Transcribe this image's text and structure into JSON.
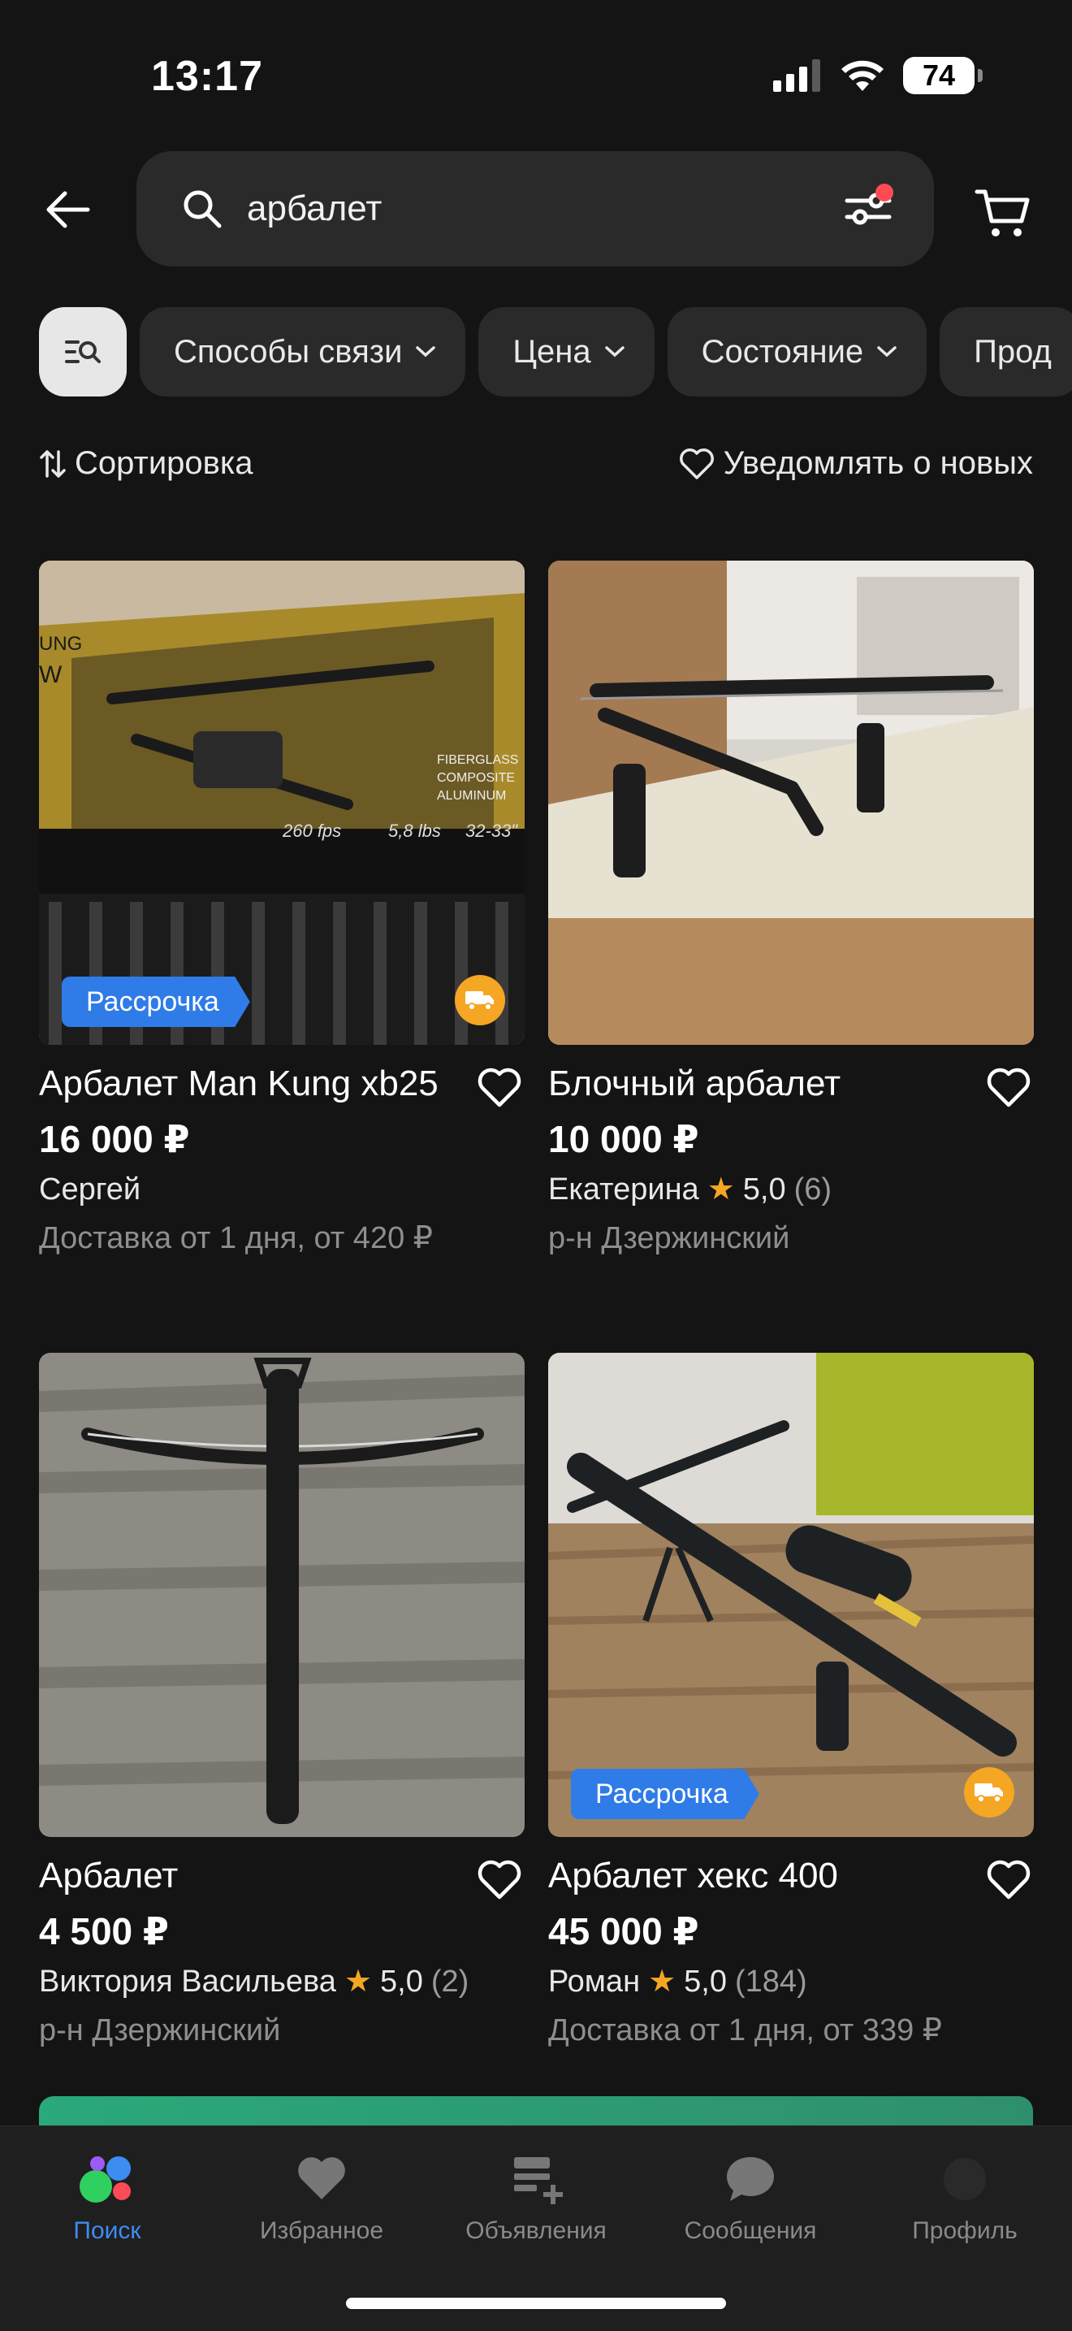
{
  "status_bar": {
    "time": "13:17",
    "battery": "74"
  },
  "search": {
    "query": "арбалет"
  },
  "filters": {
    "chips": [
      "Способы связи",
      "Цена",
      "Состояние",
      "Прод"
    ]
  },
  "sort": {
    "label": "Сортировка",
    "notify": "Уведомлять о новых"
  },
  "listings": [
    {
      "title": "Арбалет Man Kung xb25",
      "price": "16 000 ₽",
      "seller": "Сергей",
      "meta": "Доставка от 1 дня, от 420 ₽",
      "badge": "Рассрочка",
      "photo_text": {
        "a": "FIBERGLASS",
        "b": "COMPOSITE",
        "c": "ALUMINUM",
        "d": "260 fps",
        "e": "5,8 lbs",
        "f": "32-33\"",
        "g": "UNG",
        "h": "W"
      }
    },
    {
      "title": "Блочный арбалет",
      "price": "10 000 ₽",
      "seller": "Екатерина",
      "rating": "5,0",
      "reviews": "(6)",
      "meta": "р-н Дзержинский"
    },
    {
      "title": "Арбалет",
      "price": "4 500 ₽",
      "seller": "Виктория Васильева",
      "rating": "5,0",
      "reviews": "(2)",
      "meta": "р-н Дзержинский"
    },
    {
      "title": "Арбалет хекс 400",
      "price": "45 000 ₽",
      "seller": "Роман",
      "rating": "5,0",
      "reviews": "(184)",
      "meta": "Доставка от 1 дня, от 339 ₽",
      "badge": "Рассрочка"
    }
  ],
  "tabbar": {
    "tabs": [
      {
        "label": "Поиск",
        "active": true
      },
      {
        "label": "Избранное"
      },
      {
        "label": "Объявления"
      },
      {
        "label": "Сообщения"
      },
      {
        "label": "Профиль"
      }
    ]
  },
  "colors": {
    "accent": "#3d8cf2",
    "badge": "#2f7be8",
    "star": "#f5a623",
    "background": "#141414"
  }
}
